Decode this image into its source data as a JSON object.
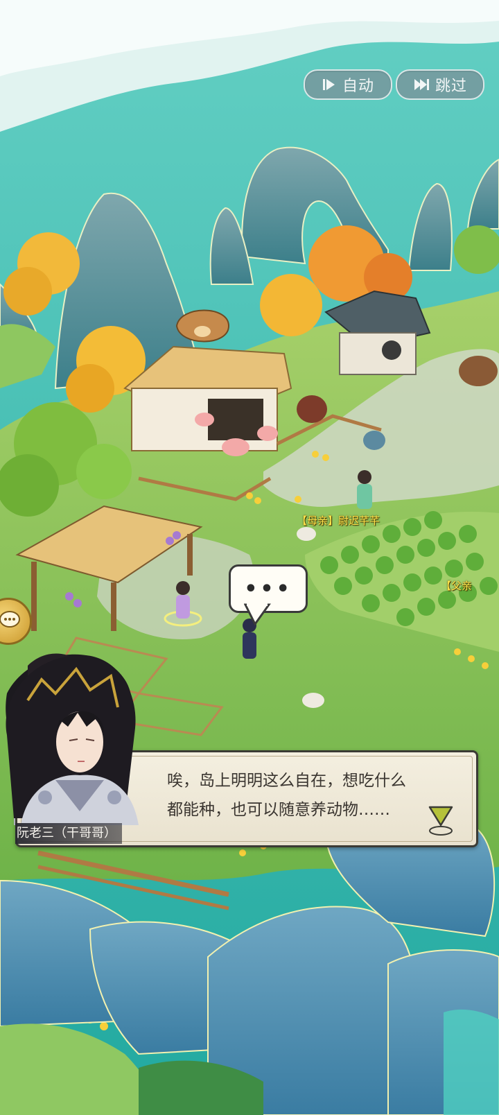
{
  "top_buttons": {
    "auto_label": "自动",
    "skip_label": "跳过"
  },
  "map_labels": {
    "mother": "【母亲】尉迟芊芊",
    "father": "【父亲"
  },
  "thought_bubble": {
    "text": "•••"
  },
  "dialogue": {
    "speaker": "阮老三（干哥哥）",
    "line1": "唉，岛上明明这么自在，想吃什么",
    "line2": "都能种，也可以随意养动物……"
  },
  "icons": {
    "auto": "play-icon",
    "skip": "skip-icon",
    "advance": "down-arrow-icon",
    "side": "chat-icon"
  },
  "colors": {
    "sea": "#2bb6a7",
    "grass": "#8cc251",
    "name_tag": "#ffe14a",
    "dialog_bg": "#f4efe0"
  }
}
